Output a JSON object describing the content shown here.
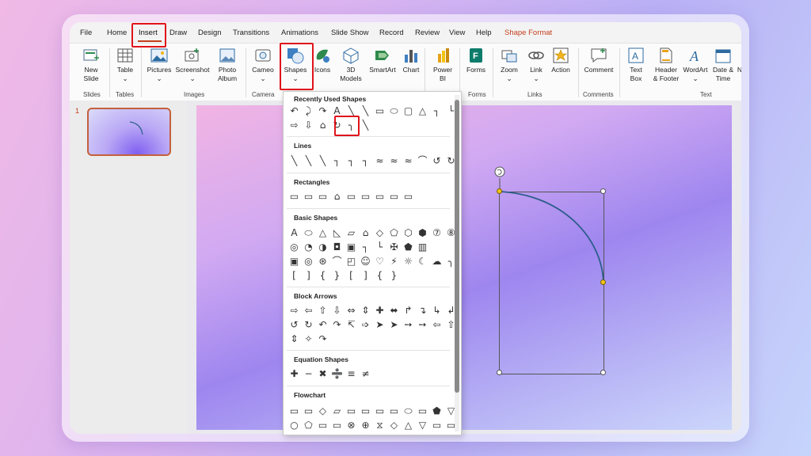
{
  "menu_tabs": [
    "File",
    "Home",
    "Insert",
    "Draw",
    "Design",
    "Transitions",
    "Animations",
    "Slide Show",
    "Record",
    "Review",
    "View",
    "Help",
    "Shape Format"
  ],
  "ribbon": {
    "new_slide": [
      "New",
      "Slide"
    ],
    "table": "Table",
    "pictures": "Pictures",
    "screenshot": "Screenshot",
    "photo_album": [
      "Photo",
      "Album"
    ],
    "cameo": "Cameo",
    "shapes": "Shapes",
    "icons": "Icons",
    "models_3d": [
      "3D",
      "Models"
    ],
    "smartart": "SmartArt",
    "chart": "Chart",
    "power_bi": [
      "Power",
      "BI"
    ],
    "forms": "Forms",
    "zoom": "Zoom",
    "link": "Link",
    "action": "Action",
    "comment": "Comment",
    "text_box": [
      "Text",
      "Box"
    ],
    "header_footer": [
      "Header",
      "& Footer"
    ],
    "wordart": "WordArt",
    "date_time": [
      "Date &",
      "Time"
    ],
    "n_cut": "N",
    "groups": [
      "Slides",
      "Tables",
      "Images",
      "Camera",
      "Forms",
      "Links",
      "Comments",
      "Text"
    ]
  },
  "slide_panel": {
    "slide_number": "1"
  },
  "shapes_menu": {
    "sections": [
      {
        "title": "Recently Used Shapes",
        "rows": [
          [
            "↶",
            "⤸",
            "↷",
            "A",
            "╲",
            "╲",
            "▭",
            "⬭",
            "▢",
            "△",
            "┐",
            "└"
          ],
          [
            "⇨",
            "⇩",
            "⌂",
            "↻",
            "╮",
            "╲"
          ]
        ]
      },
      {
        "title": "Lines",
        "rows": [
          [
            "╲",
            "╲",
            "╲",
            "┐",
            "┐",
            "┐",
            "≈",
            "≈",
            "≈",
            "⌒",
            "↺",
            "↻"
          ]
        ]
      },
      {
        "title": "Rectangles",
        "rows": [
          [
            "▭",
            "▭",
            "▭",
            "⌂",
            "▭",
            "▭",
            "▭",
            "▭",
            "▭"
          ]
        ]
      },
      {
        "title": "Basic Shapes",
        "rows": [
          [
            "A",
            "⬭",
            "△",
            "◺",
            "▱",
            "⌂",
            "◇",
            "⬠",
            "⬡",
            "⬢",
            "⑦",
            "⑧",
            "⑩"
          ],
          [
            "◎",
            "◔",
            "◑",
            "◘",
            "▣",
            "┐",
            "└",
            "✠",
            "⬟",
            "▥"
          ],
          [
            "▣",
            "◎",
            "⊛",
            "⌒",
            "◰",
            "☺",
            "♡",
            "⚡",
            "☼",
            "☾",
            "☁",
            "╮"
          ],
          [
            "[",
            "]",
            "{",
            "}",
            "[",
            "]",
            "{",
            "}"
          ]
        ]
      },
      {
        "title": "Block Arrows",
        "rows": [
          [
            "⇨",
            "⇦",
            "⇧",
            "⇩",
            "⇔",
            "⇕",
            "✚",
            "⬌",
            "↱",
            "↴",
            "↳",
            "↲"
          ],
          [
            "↺",
            "↻",
            "↶",
            "↷",
            "↸",
            "➩",
            "➤",
            "➤",
            "➙",
            "➙",
            "⇦",
            "⇧"
          ],
          [
            "⇕",
            "✧",
            "↷"
          ]
        ]
      },
      {
        "title": "Equation Shapes",
        "rows": [
          [
            "✚",
            "−",
            "✖",
            "➗",
            "≡",
            "≠"
          ]
        ]
      },
      {
        "title": "Flowchart",
        "rows": [
          [
            "▭",
            "▭",
            "◇",
            "▱",
            "▭",
            "▭",
            "▭",
            "▭",
            "⬭",
            "▭",
            "⬟",
            "▽"
          ],
          [
            "○",
            "⬠",
            "▭",
            "▭",
            "⊗",
            "⊕",
            "⧖",
            "◇",
            "△",
            "▽",
            "▭",
            "▭"
          ]
        ]
      }
    ]
  },
  "colors": {
    "accent_red": "#e0141b",
    "arc_stroke": "#2b5c8a",
    "handle_yellow": "#f2c513"
  }
}
